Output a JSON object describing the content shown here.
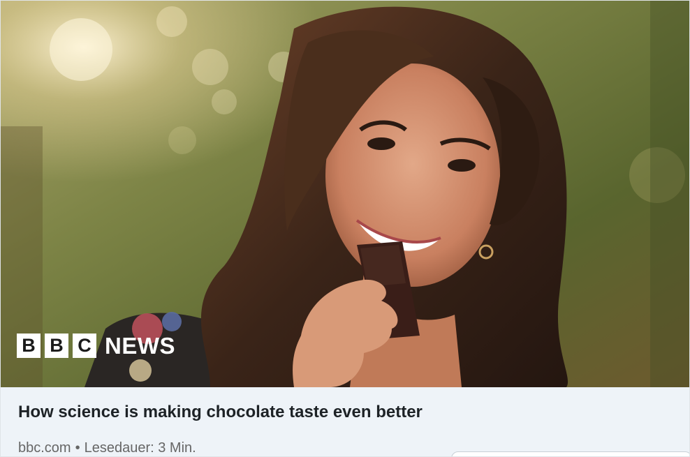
{
  "article": {
    "title": "How science is making chocolate taste even better",
    "source": "bbc.com",
    "separator": "•",
    "reading_time": "Lesedauer: 3 Min."
  },
  "thumbnail": {
    "logo_letters": [
      "B",
      "B",
      "C"
    ],
    "logo_word": "NEWS"
  },
  "colors": {
    "card_background": "#eef3f8",
    "title_text": "#1d2226",
    "meta_text": "#666666"
  }
}
